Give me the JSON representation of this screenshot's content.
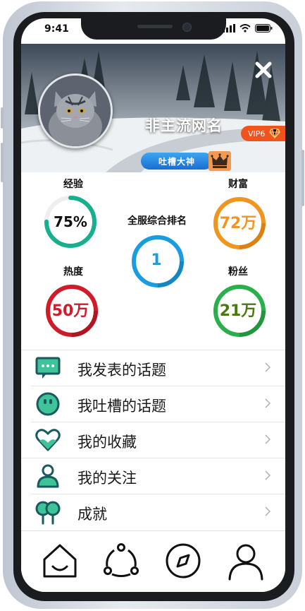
{
  "status_bar": {
    "time": "9:41"
  },
  "profile": {
    "username": "非主流网名",
    "vip_level": "VIP6",
    "title_badge": "吐槽大神"
  },
  "stats": {
    "experience": {
      "label": "经验",
      "value": "75%",
      "progress": 0.75,
      "color": "#17b08f"
    },
    "wealth": {
      "label": "财富",
      "value": "72万",
      "color": "#f0961e"
    },
    "rank": {
      "label": "全服综合排名",
      "value": "1",
      "color": "#1a9de0"
    },
    "heat": {
      "label": "热度",
      "value": "50万",
      "color": "#d01c2a"
    },
    "fans": {
      "label": "粉丝",
      "value": "21万",
      "color": "#2ab04a"
    }
  },
  "menu": {
    "items": [
      {
        "label": "我发表的话题",
        "icon": "chat-bubble-icon"
      },
      {
        "label": "我吐槽的话题",
        "icon": "smiley-face-icon"
      },
      {
        "label": "我的收藏",
        "icon": "heart-icon"
      },
      {
        "label": "我的关注",
        "icon": "person-icon"
      },
      {
        "label": "成就",
        "icon": "trees-icon"
      }
    ]
  },
  "tabbar": {
    "items": [
      {
        "name": "home",
        "icon": "home-icon"
      },
      {
        "name": "share",
        "icon": "share-icon"
      },
      {
        "name": "discover",
        "icon": "compass-icon"
      },
      {
        "name": "profile",
        "icon": "user-icon"
      }
    ]
  },
  "colors": {
    "accent_teal": "#1a5a5e",
    "icon_green": "#3ec498",
    "vip_orange": "#f0541e"
  }
}
